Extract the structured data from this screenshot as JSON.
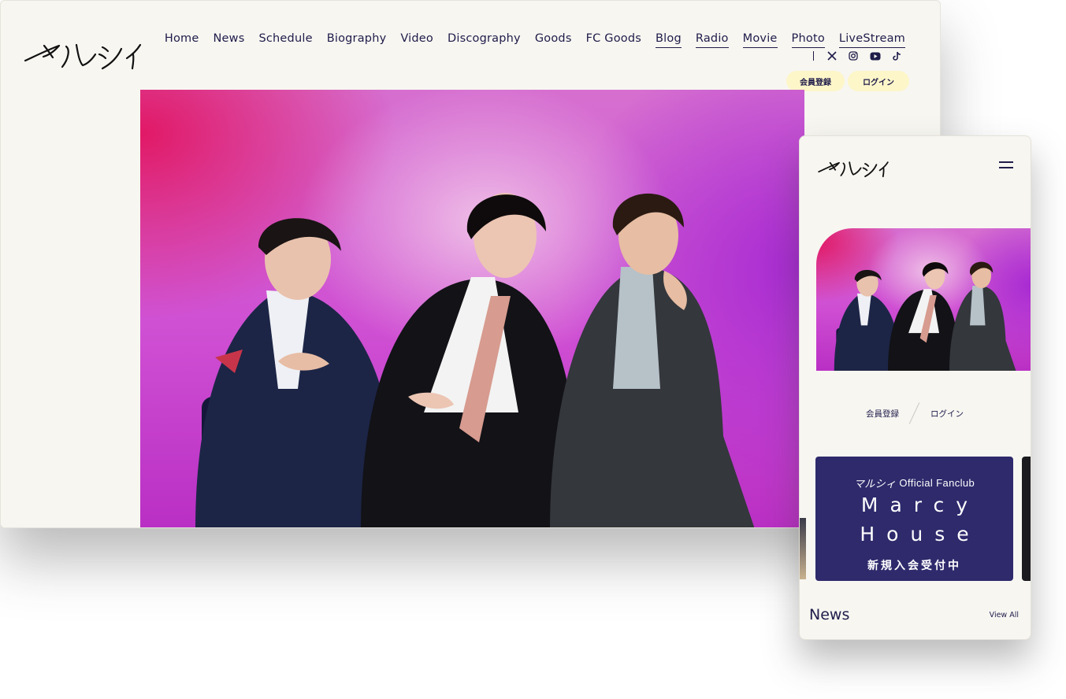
{
  "desktop": {
    "logo_text": "マルシィ",
    "nav": [
      {
        "label": "Home",
        "underlined": false
      },
      {
        "label": "News",
        "underlined": false
      },
      {
        "label": "Schedule",
        "underlined": false
      },
      {
        "label": "Biography",
        "underlined": false
      },
      {
        "label": "Video",
        "underlined": false
      },
      {
        "label": "Discography",
        "underlined": false
      },
      {
        "label": "Goods",
        "underlined": false
      },
      {
        "label": "FC Goods",
        "underlined": false
      },
      {
        "label": "Blog",
        "underlined": true
      },
      {
        "label": "Radio",
        "underlined": true
      },
      {
        "label": "Movie",
        "underlined": true
      },
      {
        "label": "Photo",
        "underlined": true
      },
      {
        "label": "LiveStream",
        "underlined": true
      }
    ],
    "social_icons": [
      "x-icon",
      "instagram-icon",
      "youtube-icon",
      "tiktok-icon"
    ],
    "register_label": "会員登録",
    "login_label": "ログイン"
  },
  "mobile": {
    "logo_text": "マルシィ",
    "register_label": "会員登録",
    "login_label": "ログイン",
    "banner": {
      "logo_text": "マルシィ",
      "fanclub_label": "Official Fanclub",
      "line1": "Marcy",
      "line2": "House",
      "recruit": "新規入会受付中"
    },
    "news_title": "News",
    "view_all": "View All"
  },
  "colors": {
    "page_bg": "#f7f6f1",
    "text_navy": "#1f1c4a",
    "pill_yellow": "#fdf6c9",
    "banner_navy": "#2e2a6c",
    "hero_magenta": "#cf4fd3"
  }
}
